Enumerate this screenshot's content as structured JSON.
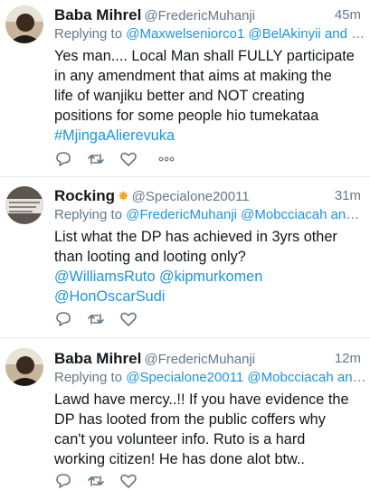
{
  "tweets": [
    {
      "name": "Baba Mihrel",
      "handle": "@FredericMuhanji",
      "time": "45m",
      "replying_label": "Replying to",
      "replying_handles": "@Maxwelseniorco1 @BelAkinyii and 2...",
      "text_lines": [
        "Yes man.... Local Man shall FULLY participate",
        "in any amendment that aims at making the",
        "life of wanjiku better and NOT creating",
        "positions for some people hio tumekataa"
      ],
      "hashtag": "#MjingaAlierevuka",
      "avatar_icon": "profile-photo"
    },
    {
      "name": "Rocking",
      "badge_icon": "star-badge-icon",
      "handle": "@Specialone20011",
      "time": "31m",
      "replying_label": "Replying to",
      "replying_handles": "@FredericMuhanji @Mobcciacah and ...",
      "text_lines": [
        "List what the DP has achieved in 3yrs other",
        "than looting and looting only?"
      ],
      "mention_line_1": "@WilliamsRuto @kipmurkomen",
      "mention_line_2": "@HonOscarSudi",
      "avatar_icon": "profile-photo"
    },
    {
      "name": "Baba Mihrel",
      "handle": "@FredericMuhanji",
      "time": "12m",
      "replying_label": "Replying to",
      "replying_handles": "@Specialone20011 @Mobcciacah and...",
      "text_lines": [
        "Lawd have mercy..!! If you have evidence the",
        "DP has looted from the public coffers why",
        "can't you volunteer info. Ruto is a hard",
        "working citizen! He has done alot btw.."
      ],
      "avatar_icon": "profile-photo"
    }
  ],
  "colors": {
    "link": "#1b95e0",
    "muted": "#657786",
    "text": "#14171a",
    "badge": "#f5a623"
  },
  "action_icons": [
    "reply-icon",
    "retweet-icon",
    "like-icon",
    "more-icon"
  ]
}
